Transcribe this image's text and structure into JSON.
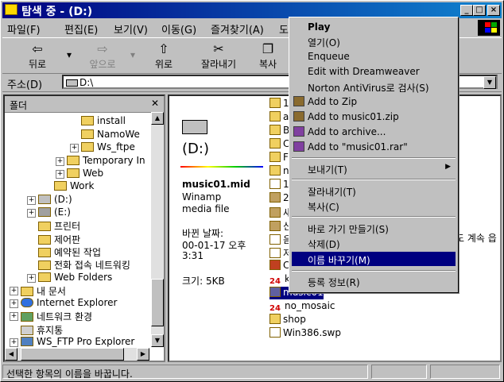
{
  "window": {
    "title": "탐색 중 - (D:)"
  },
  "menubar": [
    "파일(F)",
    "편집(E)",
    "보기(V)",
    "이동(G)",
    "즐겨찾기(A)",
    "도"
  ],
  "toolbar": {
    "back": "뒤로",
    "forward": "앞으로",
    "up": "위로",
    "cut": "잘라내기",
    "copy": "복사"
  },
  "address": {
    "label": "주소(D)",
    "value": "D:\\"
  },
  "folders": {
    "header": "폴더",
    "close": "✕",
    "items": [
      "install",
      "NamoWe",
      "Ws_ftpe",
      "Temporary In",
      "Web",
      "Work",
      "(D:)",
      "(E:)",
      "프린터",
      "제어판",
      "예약된 작업",
      "전화 접속 네트워킹",
      "Web Folders",
      "내 문서",
      "Internet Explorer",
      "네트워크 환경",
      "휴지통",
      "WS_FTP Pro Explorer"
    ]
  },
  "info": {
    "drive": "(D:)",
    "file_name": "music01.mid",
    "app": "Winamp",
    "type": "media file",
    "modified_label": "바뀐 날짜:",
    "modified_value": "00-01-17 오후",
    "modified_time": "3:31",
    "size": "크기: 5KB"
  },
  "files": [
    "1",
    "a",
    "B",
    "C",
    "Fl",
    "n",
    "1",
    "2",
    "새",
    "신",
    "음",
    "저",
    "C",
    "ko",
    "music01",
    "no_mosaic",
    "shop",
    "Win386.swp"
  ],
  "files_truncated_text": "도 계속 읍",
  "context_menu": {
    "items": [
      "Play",
      "열기(O)",
      "Enqueue",
      "Edit with Dreamweaver",
      "Norton AntiVirus로 검사(S)",
      "Add to Zip",
      "Add to music01.zip",
      "Add to archive...",
      "Add to \"music01.rar\"",
      "보내기(T)",
      "잘라내기(T)",
      "복사(C)",
      "바로 가기 만들기(S)",
      "삭제(D)",
      "이름 바꾸기(M)",
      "등록 정보(R)"
    ]
  },
  "status": {
    "text": "선택한 항목의 이름을 바꿉니다."
  },
  "colors": {
    "selection": "#000080",
    "title_start": "#000080",
    "title_end": "#1084d0",
    "face": "#c0c0c0"
  }
}
